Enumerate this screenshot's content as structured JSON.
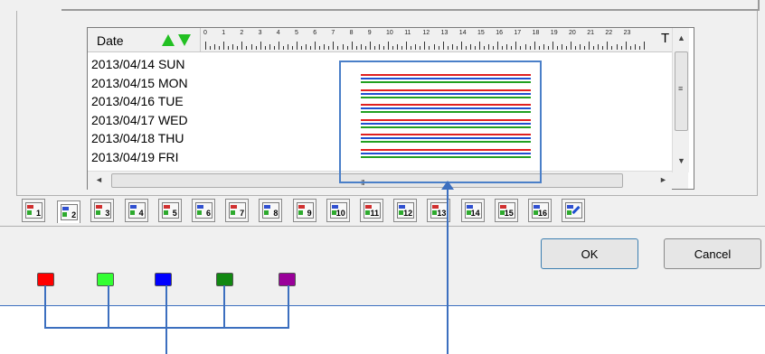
{
  "grid": {
    "header_date": "Date",
    "header_end": "T",
    "hours": [
      "0",
      "1",
      "2",
      "3",
      "4",
      "5",
      "6",
      "7",
      "8",
      "9",
      "10",
      "11",
      "12",
      "13",
      "14",
      "15",
      "16",
      "17",
      "18",
      "19",
      "20",
      "21",
      "22",
      "23"
    ],
    "rows": [
      "2013/04/14 SUN",
      "2013/04/15 MON",
      "2013/04/16 TUE",
      "2013/04/17 WED",
      "2013/04/18 THU",
      "2013/04/19 FRI"
    ],
    "record_colors": [
      "#e02020",
      "#2050d0",
      "#20a020"
    ],
    "scroll_grip": "III"
  },
  "scroll_glyphs": {
    "up": "▲",
    "down": "▼",
    "left": "◄",
    "right": "►",
    "grip": "≡"
  },
  "tabs": [
    "1",
    "2",
    "3",
    "4",
    "5",
    "6",
    "7",
    "8",
    "9",
    "10",
    "11",
    "12",
    "13",
    "14",
    "15",
    "16",
    ""
  ],
  "active_tab_index": 1,
  "buttons": {
    "ok": "OK",
    "cancel": "Cancel"
  },
  "swatches": [
    "#ff0000",
    "#33ff33",
    "#0000ff",
    "#118811",
    "#990099"
  ],
  "annotation_color": "#3c6fbf"
}
